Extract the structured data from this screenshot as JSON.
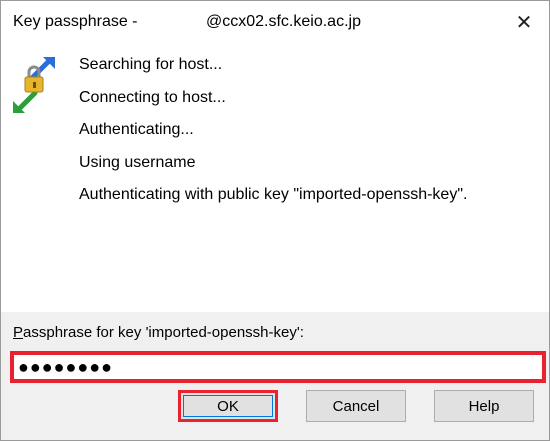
{
  "window": {
    "title_left": "Key passphrase -",
    "title_right": "@ccx02.sfc.keio.ac.jp",
    "close_glyph": "✕"
  },
  "icon": {
    "name": "key-lock-icon"
  },
  "status_lines": [
    "Searching for host...",
    "Connecting to host...",
    "Authenticating...",
    "Using username",
    "Authenticating with public key \"imported-openssh-key\"."
  ],
  "passphrase": {
    "label_underlined": "P",
    "label_rest": "assphrase for key 'imported-openssh-key':",
    "value": "●●●●●●●●"
  },
  "buttons": {
    "ok": "OK",
    "cancel": "Cancel",
    "help": "Help"
  },
  "colors": {
    "highlight_red": "#e8232f",
    "panel_gray": "#f0f0f0",
    "button_face": "#e1e1e1"
  }
}
